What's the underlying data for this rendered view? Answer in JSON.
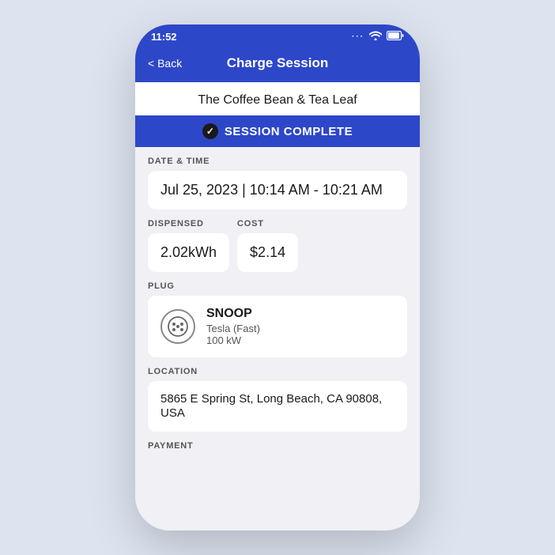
{
  "statusBar": {
    "time": "11:52",
    "dots": "···",
    "wifi": "WiFi",
    "battery": "Battery"
  },
  "navBar": {
    "backLabel": "< Back",
    "title": "Charge Session"
  },
  "locationName": "The Coffee Bean & Tea Leaf",
  "sessionStatus": "SESSION COMPLETE",
  "sections": {
    "dateTime": {
      "label": "DATE & TIME",
      "value": "Jul 25, 2023 | 10:14 AM - 10:21 AM"
    },
    "dispensed": {
      "label": "DISPENSED",
      "value": "2.02kWh"
    },
    "cost": {
      "label": "COST",
      "value": "$2.14"
    },
    "plug": {
      "label": "PLUG",
      "name": "SNOOP",
      "type": "Tesla (Fast)",
      "power": "100 kW"
    },
    "location": {
      "label": "LOCATION",
      "value": "5865 E Spring St, Long Beach, CA 90808, USA"
    },
    "payment": {
      "label": "PAYMENT"
    }
  }
}
